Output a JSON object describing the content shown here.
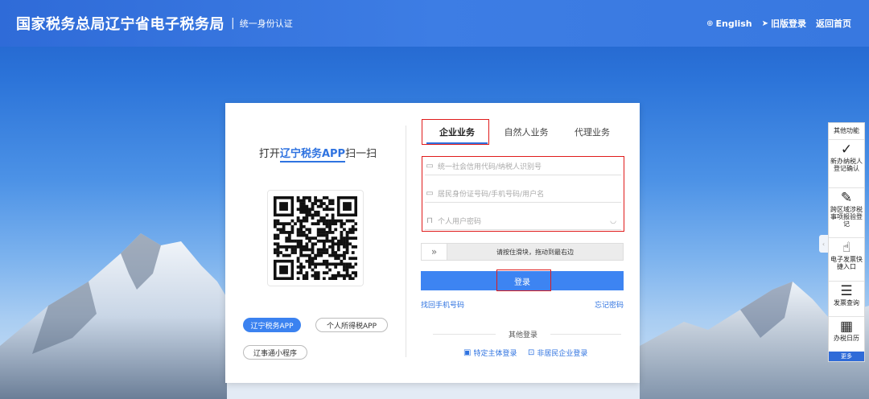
{
  "header": {
    "site_title": "国家税务总局辽宁省电子税务局",
    "divider": "|",
    "subtitle": "统一身份认证",
    "english_label": "English",
    "old_login_label": "旧版登录",
    "home_label": "返回首页"
  },
  "qr": {
    "title_prefix": "打开",
    "title_app": "辽宁税务APP",
    "title_suffix": "扫一扫",
    "pill_lntax": "辽宁税务APP",
    "pill_personal": "个人所得税APP",
    "pill_mini": "辽事通小程序"
  },
  "tabs": {
    "enterprise": "企业业务",
    "natural": "自然人业务",
    "agent": "代理业务"
  },
  "form": {
    "credit_code_placeholder": "统一社会信用代码/纳税人识别号",
    "id_placeholder": "居民身份证号码/手机号码/用户名",
    "password_placeholder": "个人用户密码",
    "slider_text": "请按住滑块，拖动到最右边",
    "login_label": "登录",
    "recover_phone": "找回手机号码",
    "forgot_password": "忘记密码",
    "other_login": "其他登录",
    "special_entity": "特定主体登录",
    "non_resident": "非居民企业登录"
  },
  "sidebar": {
    "title": "其他功能",
    "items": [
      {
        "label": "新办纳税人登记确认",
        "icon": "check-icon"
      },
      {
        "label": "跨区域涉税事项报验登记",
        "icon": "pen-icon"
      },
      {
        "label": "电子发票快捷入口",
        "icon": "hand-pointer-icon"
      },
      {
        "label": "发票查询",
        "icon": "document-icon"
      },
      {
        "label": "办税日历",
        "icon": "calendar-icon"
      }
    ],
    "more": "更多"
  }
}
